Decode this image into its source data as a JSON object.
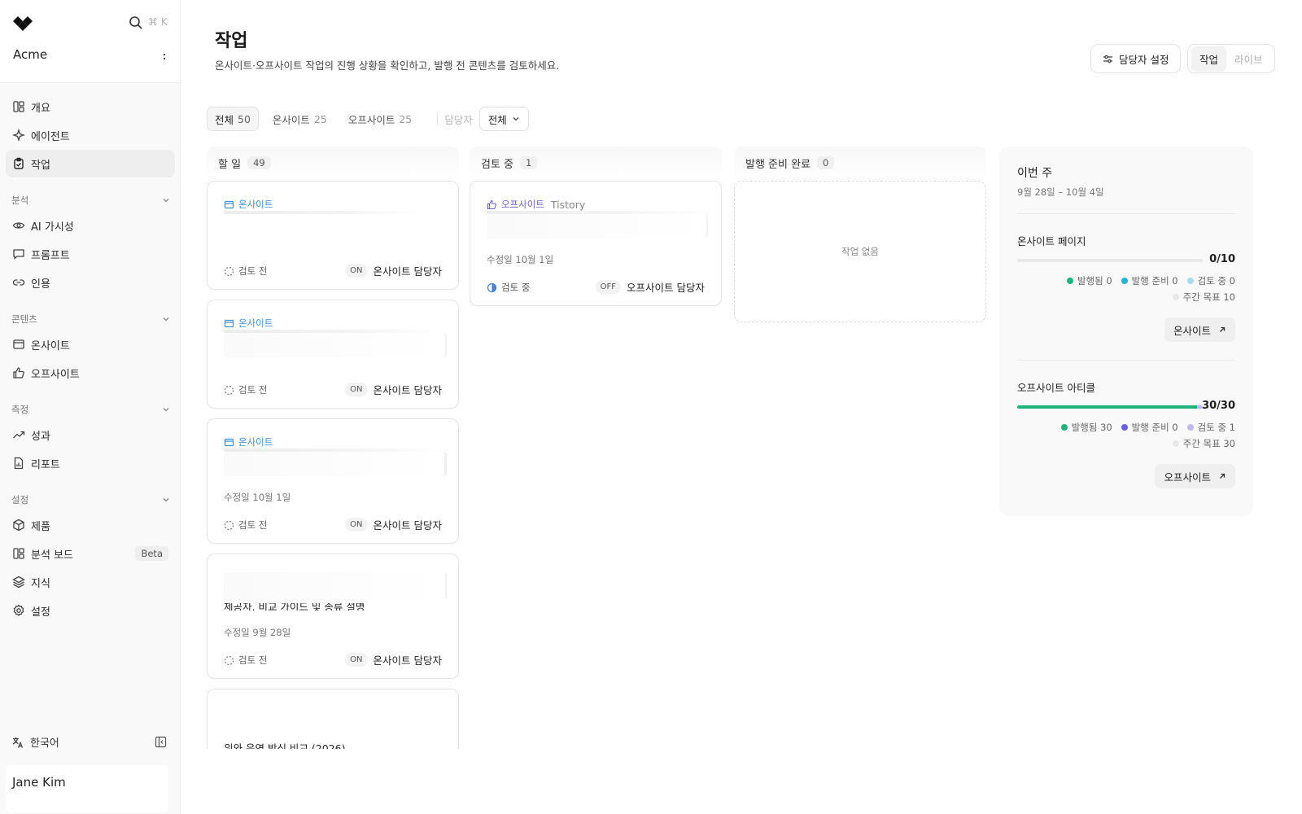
{
  "app": {
    "org_name": "Acme",
    "search_shortcut": "⌘ K",
    "user_name": "Jane Kim",
    "language": "한국어"
  },
  "sidebar": {
    "items_top": [
      {
        "label": "개요",
        "icon": "layout-icon"
      },
      {
        "label": "에이전트",
        "icon": "sparkle-icon"
      },
      {
        "label": "작업",
        "icon": "clipboard-icon",
        "active": true
      }
    ],
    "sections": [
      {
        "title": "분석",
        "items": [
          {
            "label": "AI 가시성",
            "icon": "eye-icon"
          },
          {
            "label": "프롬프트",
            "icon": "message-icon"
          },
          {
            "label": "인용",
            "icon": "link-icon"
          }
        ]
      },
      {
        "title": "콘텐츠",
        "items": [
          {
            "label": "온사이트",
            "icon": "browser-icon"
          },
          {
            "label": "오프사이트",
            "icon": "thumbs-up-icon"
          }
        ]
      },
      {
        "title": "측정",
        "items": [
          {
            "label": "성과",
            "icon": "trend-icon"
          },
          {
            "label": "리포트",
            "icon": "report-icon"
          }
        ]
      },
      {
        "title": "설정",
        "items": [
          {
            "label": "제품",
            "icon": "box-icon"
          },
          {
            "label": "분석 보드",
            "icon": "layout-icon",
            "badge": "Beta"
          },
          {
            "label": "지식",
            "icon": "layers-icon"
          },
          {
            "label": "설정",
            "icon": "gear-icon"
          }
        ]
      }
    ]
  },
  "header": {
    "title": "작업",
    "subtitle": "온사이트·오프사이트 작업의 진행 상황을 확인하고, 발행 전 콘텐츠를 검토하세요.",
    "owner_button": "담당자 설정",
    "view_tabs": [
      {
        "label": "작업",
        "active": true
      },
      {
        "label": "라이브",
        "active": false
      }
    ]
  },
  "filters": {
    "chips": [
      {
        "label": "전체",
        "count": "50",
        "active": true
      },
      {
        "label": "온사이트",
        "count": "25",
        "active": false
      },
      {
        "label": "오프사이트",
        "count": "25",
        "active": false
      }
    ],
    "owner_label": "담당자",
    "owner_value": "전체"
  },
  "columns": [
    {
      "title": "할 일",
      "count": "49"
    },
    {
      "title": "검토 중",
      "count": "1"
    },
    {
      "title": "발행 준비 완료",
      "count": "0",
      "empty_text": "작업 없음"
    }
  ],
  "todo_cards": [
    {
      "type": "온사이트",
      "status": "검토 전",
      "owner_tag": "ON",
      "owner": "온사이트 담당자"
    },
    {
      "type": "온사이트",
      "status": "검토 전",
      "owner_tag": "ON",
      "owner": "온사이트 담당자"
    },
    {
      "type": "온사이트",
      "date": "수정일 10월 1일",
      "status": "검토 전",
      "owner_tag": "ON",
      "owner": "온사이트 담당자"
    },
    {
      "title_partial": "제공자, 비교 가이드 및 종류 설명",
      "date": "수정일 9월 28일",
      "status": "검토 전",
      "owner_tag": "ON",
      "owner": "온사이트 담당자"
    },
    {
      "title": "위와 운영 방식 비교 (2026)"
    }
  ],
  "review_cards": [
    {
      "type": "오프사이트",
      "platform": "Tistory",
      "date": "수정일 10월 1일",
      "status": "검토 중",
      "owner_tag": "OFF",
      "owner": "오프사이트 담당자"
    }
  ],
  "week": {
    "title": "이번 주",
    "range": "9월 28일 – 10월 4일",
    "onsite": {
      "title": "온사이트 페이지",
      "value": "0/10",
      "progress": 0,
      "legend": [
        {
          "label": "발행됨 0",
          "color": "#1fb37c"
        },
        {
          "label": "발행 준비 0",
          "color": "#2bb0d8"
        },
        {
          "label": "검토 중 0",
          "color": "#a7dcee"
        },
        {
          "label": "주간 목표 10",
          "color": "#e8e8e8"
        }
      ],
      "button": "온사이트"
    },
    "offsite": {
      "title": "오프사이트 아티클",
      "value": "30/30",
      "progress": 0.97,
      "review_progress": 0.03,
      "legend": [
        {
          "label": "발행됨 30",
          "color": "#1fb37c"
        },
        {
          "label": "발행 준비 0",
          "color": "#6b5fd6"
        },
        {
          "label": "검토 중 1",
          "color": "#c2b8f0"
        },
        {
          "label": "주간 목표 30",
          "color": "#e8e8e8"
        }
      ],
      "button": "오프사이트"
    }
  },
  "colors": {
    "onsite_accent": "#3b8fd6",
    "offsite_accent": "#6b5fd6",
    "published": "#1fb37c"
  }
}
